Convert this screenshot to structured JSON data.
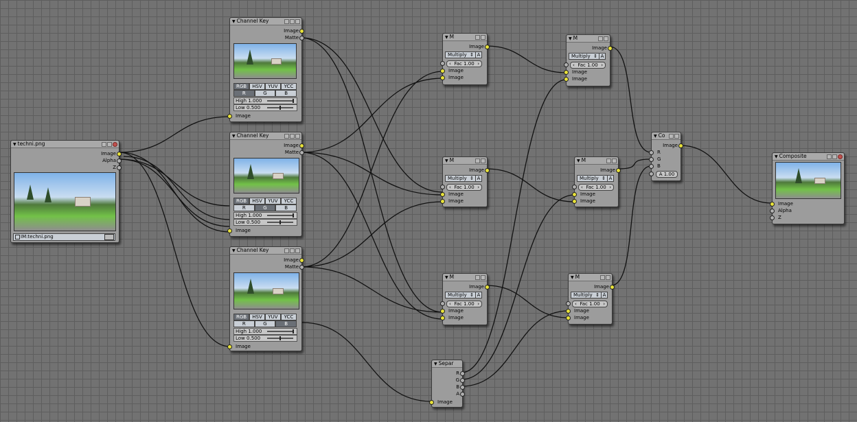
{
  "colors": {
    "image_socket": "#e8e23a",
    "value_socket": "#b0b0b0",
    "canvas": "#727272"
  },
  "input_node": {
    "title": "techni.png",
    "outputs": [
      "Image",
      "Alpha",
      "Z"
    ],
    "image_field": "IM:techni.png",
    "image_picker_icon": "image-browse-icon"
  },
  "channel_keys": [
    {
      "title": "Channel Key",
      "outputs": [
        "Image",
        "Matte"
      ],
      "color_space_tabs": [
        "RGB",
        "HSV",
        "YUV",
        "YCC"
      ],
      "channel_tabs": [
        "R",
        "G",
        "B"
      ],
      "active_channel": "R",
      "high": "High 1.000",
      "low": "Low 0.500",
      "input": "Image"
    },
    {
      "title": "Channel Key",
      "outputs": [
        "Image",
        "Matte"
      ],
      "color_space_tabs": [
        "RGB",
        "HSV",
        "YUV",
        "YCC"
      ],
      "channel_tabs": [
        "R",
        "G",
        "B"
      ],
      "active_channel": "G",
      "high": "High 1.000",
      "low": "Low 0.500",
      "input": "Image"
    },
    {
      "title": "Channel Key",
      "outputs": [
        "Image",
        "Matte"
      ],
      "color_space_tabs": [
        "RGB",
        "HSV",
        "YUV",
        "YCC"
      ],
      "channel_tabs": [
        "R",
        "G",
        "B"
      ],
      "active_channel": "B",
      "high": "High 1.000",
      "low": "Low 0.500",
      "input": "Image"
    }
  ],
  "mix_nodes": [
    {
      "title": "M",
      "output": "Image",
      "blend": "Multiply",
      "alpha_toggle": "A",
      "fac": "Fac 1.00",
      "inputs": [
        "Image",
        "Image"
      ]
    },
    {
      "title": "M",
      "output": "Image",
      "blend": "Multiply",
      "alpha_toggle": "A",
      "fac": "Fac 1.00",
      "inputs": [
        "Image",
        "Image"
      ]
    },
    {
      "title": "M",
      "output": "Image",
      "blend": "Multiply",
      "alpha_toggle": "A",
      "fac": "Fac 1.00",
      "inputs": [
        "Image",
        "Image"
      ]
    },
    {
      "title": "M",
      "output": "Image",
      "blend": "Multiply",
      "alpha_toggle": "A",
      "fac": "Fac 1.00",
      "inputs": [
        "Image",
        "Image"
      ]
    },
    {
      "title": "M",
      "output": "Image",
      "blend": "Multiply",
      "alpha_toggle": "A",
      "fac": "Fac 1.00",
      "inputs": [
        "Image",
        "Image"
      ]
    },
    {
      "title": "M",
      "output": "Image",
      "blend": "Multiply",
      "alpha_toggle": "A",
      "fac": "Fac 1.00",
      "inputs": [
        "Image",
        "Image"
      ]
    }
  ],
  "separate_node": {
    "title": "Separ",
    "outputs": [
      "R",
      "G",
      "B",
      "A"
    ],
    "input": "Image"
  },
  "combine_node": {
    "title": "Co",
    "output": "Image",
    "inputs": [
      "R",
      "G",
      "B"
    ],
    "alpha": "A 1.00"
  },
  "composite_node": {
    "title": "Composite",
    "inputs": [
      "Image",
      "Alpha",
      "Z"
    ]
  }
}
